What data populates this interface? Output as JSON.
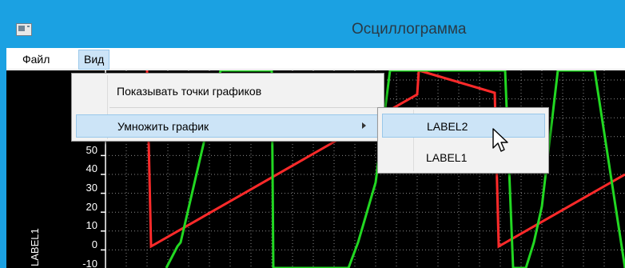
{
  "window": {
    "title": "Осциллограмма"
  },
  "menubar": {
    "items": [
      {
        "label": "Файл"
      },
      {
        "label": "Вид"
      }
    ]
  },
  "dropdown": {
    "items": [
      {
        "label": "Показывать точки графиков"
      },
      {
        "label": "Умножить график",
        "has_submenu": true
      }
    ]
  },
  "submenu": {
    "items": [
      {
        "label": "LABEL2"
      },
      {
        "label": "LABEL1"
      }
    ]
  },
  "plot": {
    "y_ticks": [
      "50",
      "40",
      "30",
      "20",
      "10",
      "0",
      "-10"
    ],
    "y_label": "LABEL1",
    "background": "#000000",
    "series_colors": [
      "#ff2a2a",
      "#22d822"
    ]
  },
  "colors": {
    "title_bar": "#1ba1e2",
    "menu_highlight": "#cce4f7",
    "menu_highlight_border": "#99c7ea",
    "menu_background": "#f2f2f2"
  }
}
